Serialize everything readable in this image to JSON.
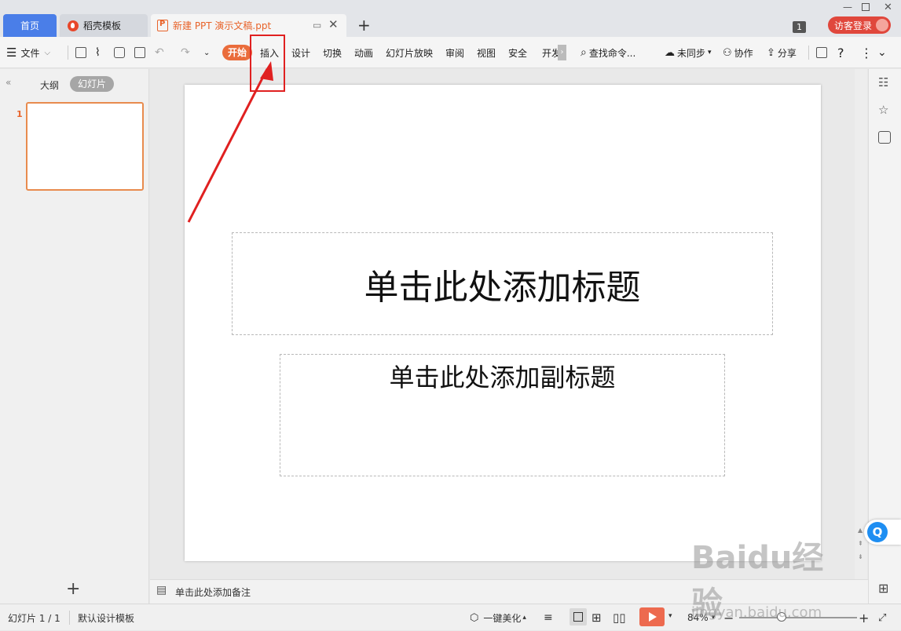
{
  "tabs": {
    "home": "首页",
    "template": "稻壳模板",
    "document": "新建 PPT 演示文稿.ppt",
    "new_tab": "+"
  },
  "window": {
    "badge": "1",
    "login": "访客登录"
  },
  "toolbar": {
    "file": "文件",
    "menus": [
      "开始",
      "插入",
      "设计",
      "切换",
      "动画",
      "幻灯片放映",
      "审阅",
      "视图",
      "安全",
      "开发"
    ],
    "search": "查找命令...",
    "sync": "未同步",
    "collab": "协作",
    "share": "分享",
    "help": "?"
  },
  "leftpane": {
    "outline_tab": "大纲",
    "slides_tab": "幻灯片",
    "thumb_number": "1",
    "add": "+"
  },
  "slide": {
    "title_placeholder": "单击此处添加标题",
    "subtitle_placeholder": "单击此处添加副标题"
  },
  "notes": {
    "placeholder": "单击此处添加备注"
  },
  "statusbar": {
    "slide_count": "幻灯片 1 / 1",
    "theme": "默认设计模板",
    "beautify": "一键美化",
    "zoom": "84%",
    "zoom_fraction": 0.36
  },
  "watermark": {
    "brand": "Baidu经验",
    "url": "jingyan.baidu.com"
  },
  "colors": {
    "accent": "#ea6c3b",
    "tab_home": "#4a7ee8",
    "highlight": "#e02020",
    "login": "#e0473c"
  }
}
